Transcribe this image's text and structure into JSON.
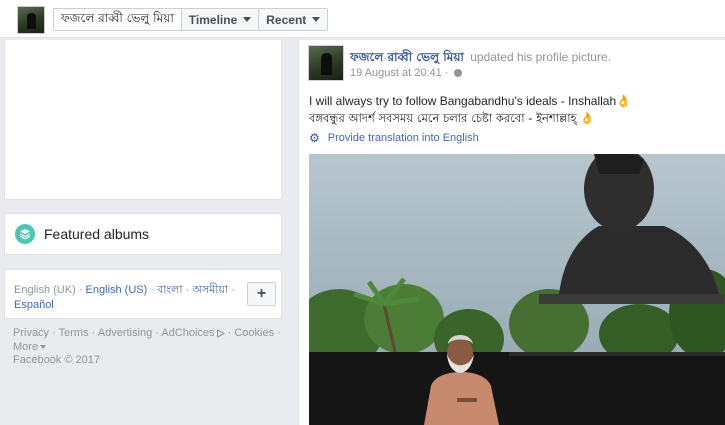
{
  "topbar": {
    "profile_name": "ফজলে রাব্বী ভেলু মিয়া",
    "timeline_label": "Timeline",
    "recent_label": "Recent"
  },
  "left": {
    "albums_title": "Featured albums",
    "languages": {
      "current": "English (UK)",
      "options": [
        "English (US)",
        "বাংলা",
        "অসমীয়া",
        "Español"
      ]
    },
    "add_language_label": "+",
    "footer": {
      "links": [
        "Privacy",
        "Terms",
        "Advertising",
        "AdChoices",
        "Cookies"
      ],
      "more_label": "More",
      "copyright": "Facebook © 2017"
    }
  },
  "post": {
    "author": "ফজলে রাব্বী ভেলু মিয়া",
    "action": "updated his profile picture.",
    "timestamp": "19 August at 20:41 ·",
    "text_en": "I will always try to follow Bangabandhu's ideals - Inshallah👌",
    "text_bn": "বঙ্গবন্ধুর আদর্শ সবসময় মেনে চলার চেষ্টা করবো - ইনশাল্লাহ্ 👌",
    "translate_label": "Provide translation into English"
  },
  "colors": {
    "link": "#4267b2",
    "author": "#365899",
    "page_bg": "#e9ebee",
    "album_icon": "#4fc3b4"
  },
  "icons": [
    "layers-icon",
    "globe-icon",
    "gear-icon",
    "chevron-down-icon",
    "adchoices-icon"
  ]
}
